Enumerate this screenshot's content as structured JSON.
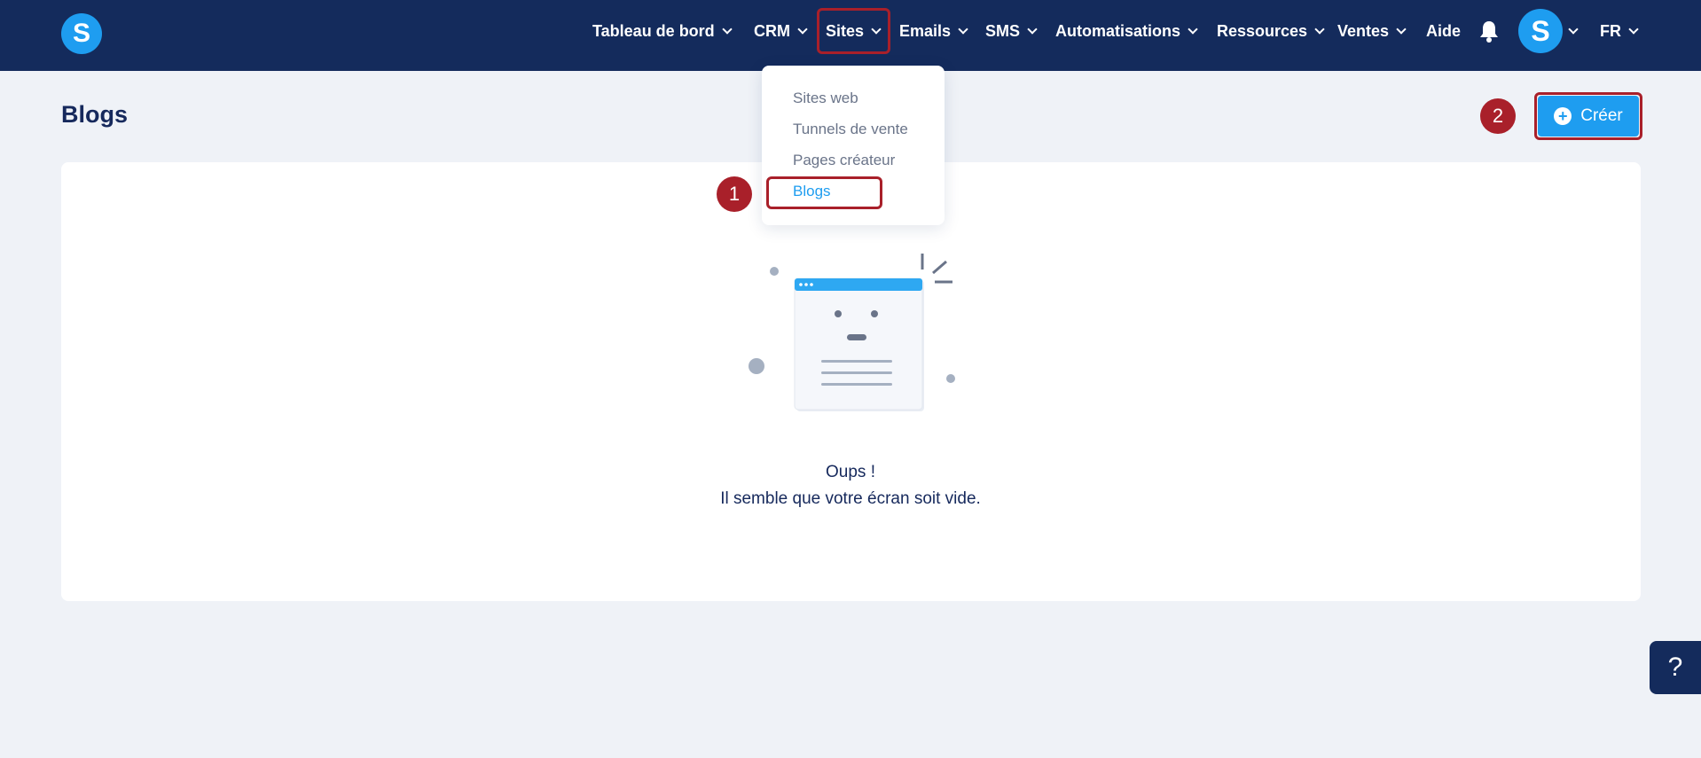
{
  "header": {
    "logo_letter": "S",
    "nav": [
      {
        "label": "Tableau de bord",
        "has_menu": true
      },
      {
        "label": "CRM",
        "has_menu": true
      },
      {
        "label": "Sites",
        "has_menu": true
      },
      {
        "label": "Emails",
        "has_menu": true
      },
      {
        "label": "SMS",
        "has_menu": true
      },
      {
        "label": "Automatisations",
        "has_menu": true
      },
      {
        "label": "Ressources",
        "has_menu": true
      },
      {
        "label": "Ventes",
        "has_menu": true
      },
      {
        "label": "Aide",
        "has_menu": false
      }
    ],
    "avatar_letter": "S",
    "language": "FR"
  },
  "sites_dropdown": {
    "items": [
      "Sites web",
      "Tunnels de vente",
      "Pages créateur",
      "Blogs"
    ],
    "active": "Blogs"
  },
  "page": {
    "title": "Blogs",
    "create_label": "Créer"
  },
  "empty_state": {
    "title": "Oups !",
    "subtitle": "Il semble que votre écran soit vide."
  },
  "annotations": [
    "1",
    "2"
  ],
  "help": {
    "label": "?"
  },
  "colors": {
    "navbar": "#142b5c",
    "accent": "#1e9df0",
    "highlight": "#a9202a",
    "background": "#eff2f7"
  }
}
